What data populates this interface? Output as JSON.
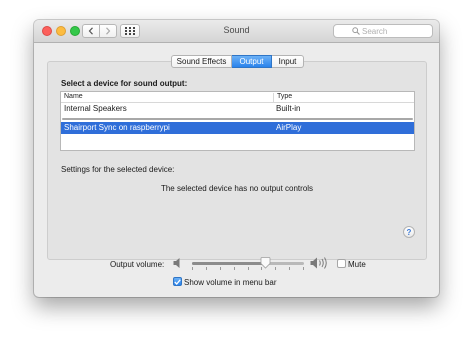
{
  "window": {
    "title": "Sound",
    "search_placeholder": "Search"
  },
  "tabs": [
    {
      "label": "Sound Effects",
      "selected": false
    },
    {
      "label": "Output",
      "selected": true
    },
    {
      "label": "Input",
      "selected": false
    }
  ],
  "output": {
    "section_label": "Select a device for sound output:",
    "columns": [
      "Name",
      "Type"
    ],
    "devices": [
      {
        "name": "Internal Speakers",
        "type": "Built-in",
        "selected": false
      },
      {
        "name": "Shairport Sync on raspberrypi",
        "type": "AirPlay",
        "selected": true
      }
    ],
    "settings_label": "Settings for the selected device:",
    "no_controls_text": "The selected device has no output controls",
    "help_label": "?"
  },
  "volume": {
    "label": "Output volume:",
    "level": 0.66,
    "mute_label": "Mute",
    "muted": false,
    "show_in_menu_label": "Show volume in menu bar",
    "show_in_menu": true
  },
  "colors": {
    "accent": "#2f6ed9",
    "close": "#fc605c",
    "minimize": "#fdbc40",
    "zoom": "#34c84a"
  },
  "icons": {
    "back": "chevron-left-icon",
    "forward": "chevron-right-icon",
    "show_all": "grid-icon",
    "search": "search-icon",
    "volume_low": "speaker-low-icon",
    "volume_high": "speaker-high-icon",
    "check": "checkmark-icon"
  }
}
